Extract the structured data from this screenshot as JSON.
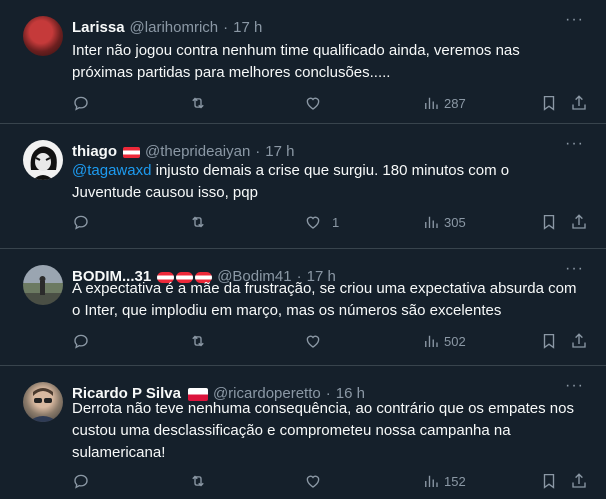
{
  "tweets": [
    {
      "name": "Larissa",
      "handle": "@larihomrich",
      "time": "17 h",
      "text": "Inter não jogou contra nenhum time qualificado ainda, veremos nas próximas partidas para melhores conclusões.....",
      "replies": "",
      "retweets": "",
      "likes": "",
      "views": "287"
    },
    {
      "name": "thiago",
      "handle": "@theprideaiyan",
      "time": "17 h",
      "mention": "@tagawaxd",
      "text": " injusto demais a crise que surgiu. 180 minutos com o Juventude causou isso, pqp",
      "replies": "",
      "retweets": "",
      "likes": "1",
      "views": "305"
    },
    {
      "name": "BODIM...31",
      "handle": "@Bodim41",
      "time": "17 h",
      "text": "A expectativa é a mãe da frustração, se criou uma expectativa absurda com o Inter, que implodiu em março, mas os números são excelentes",
      "replies": "",
      "retweets": "",
      "likes": "",
      "views": "502"
    },
    {
      "name": "Ricardo P Silva",
      "handle": "@ricardoperetto",
      "time": "16 h",
      "text": "Derrota não teve nenhuma consequência, ao contrário que os empates nos custou uma desclassificação e comprometeu nossa campanha na sulamericana!",
      "replies": "",
      "retweets": "",
      "likes": "",
      "views": "152"
    }
  ],
  "separator": "·",
  "more_label": "···",
  "icons": [
    "reply-icon",
    "retweet-icon",
    "like-icon",
    "views-icon",
    "bookmark-icon",
    "share-icon"
  ],
  "colors": {
    "background": "#15202b",
    "secondary_text": "#8b98a5",
    "mention": "#1d9bf0",
    "divider": "#38444d"
  }
}
